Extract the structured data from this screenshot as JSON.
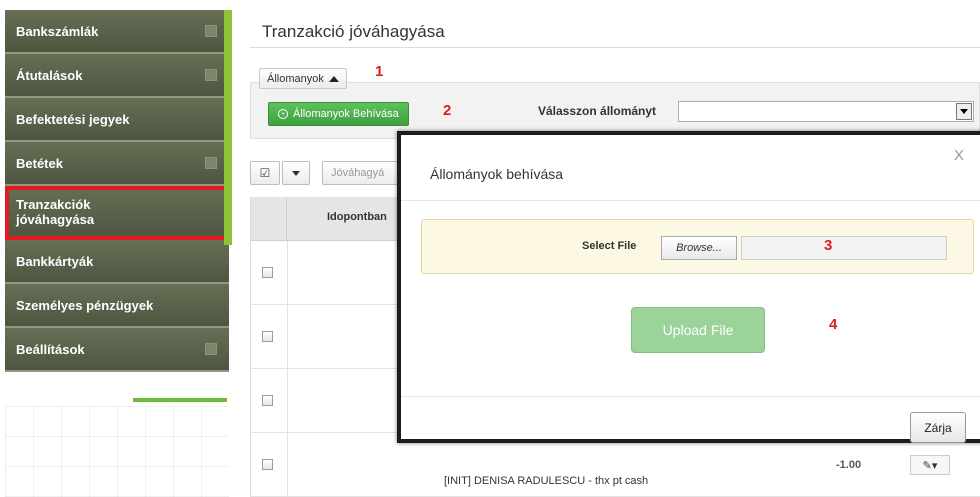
{
  "sidebar": {
    "items": [
      {
        "label": "Bankszámlák"
      },
      {
        "label": "Átutalások"
      },
      {
        "label": "Befektetési jegyek"
      },
      {
        "label": "Betétek"
      },
      {
        "label": "Tranzakciók jóváhagyása"
      },
      {
        "label": "Bankkártyák"
      },
      {
        "label": "Személyes pénzügyek"
      },
      {
        "label": "Beállítások"
      }
    ]
  },
  "main": {
    "title": "Tranzakció jóváhagyása",
    "files_tab": "Állomanyok",
    "upload_button": "Állomanyok Behívása",
    "select_label": "Válasszon állományt",
    "toolbar": {
      "approve_label": "Jóváhagyá"
    },
    "table": {
      "col_time": "Idopontban",
      "last_row_text": "[INIT] DENISA RADULESCU - thx pt cash",
      "last_row_amount": "-1.00"
    }
  },
  "annotations": {
    "n1": "1",
    "n2": "2",
    "n3": "3",
    "n4": "4"
  },
  "modal": {
    "title": "Állományok behívása",
    "close_x": "X",
    "select_file": "Select File",
    "browse": "Browse...",
    "upload": "Upload File",
    "close_button": "Zárja"
  },
  "colors": {
    "accent": "#8fc33a",
    "highlight": "#e11b22",
    "sidebar": "#5a6249"
  }
}
